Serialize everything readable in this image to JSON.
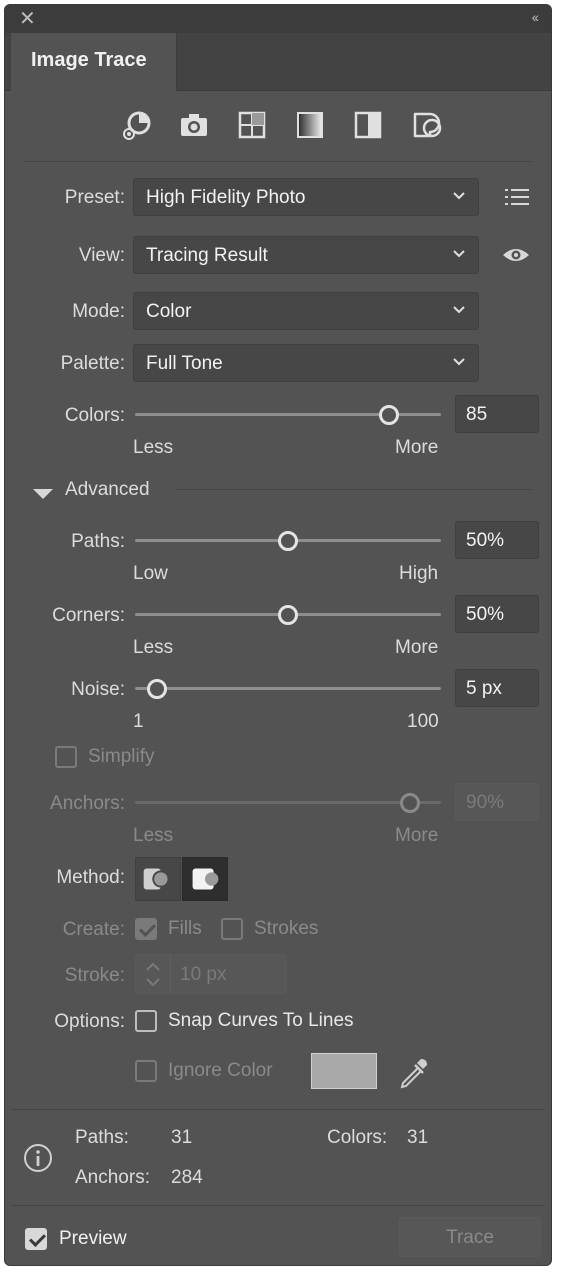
{
  "window": {
    "close_glyph": "✕",
    "collapse_glyph": "‹‹"
  },
  "tab": {
    "title": "Image Trace"
  },
  "presets_bar": [
    {
      "name": "auto-color-icon"
    },
    {
      "name": "high-color-icon"
    },
    {
      "name": "low-color-icon"
    },
    {
      "name": "grayscale-icon"
    },
    {
      "name": "black-and-white-icon"
    },
    {
      "name": "outline-icon"
    }
  ],
  "preset": {
    "label": "Preset:",
    "value": "High Fidelity Photo"
  },
  "view": {
    "label": "View:",
    "value": "Tracing Result"
  },
  "mode": {
    "label": "Mode:",
    "value": "Color"
  },
  "palette": {
    "label": "Palette:",
    "value": "Full Tone"
  },
  "colors": {
    "label": "Colors:",
    "value": "85",
    "min_label": "Less",
    "max_label": "More",
    "level": 0.83
  },
  "advanced": {
    "label": "Advanced"
  },
  "paths": {
    "label": "Paths:",
    "value": "50%",
    "min_label": "Low",
    "max_label": "High",
    "level": 0.5
  },
  "corners": {
    "label": "Corners:",
    "value": "50%",
    "min_label": "Less",
    "max_label": "More",
    "level": 0.5
  },
  "noise": {
    "label": "Noise:",
    "value": "5 px",
    "min_label": "1",
    "max_label": "100",
    "level": 0.04
  },
  "simplify": {
    "label": "Simplify"
  },
  "anchors": {
    "label": "Anchors:",
    "value": "90%",
    "min_label": "Less",
    "max_label": "More",
    "level": 0.9
  },
  "method": {
    "label": "Method:"
  },
  "create": {
    "label": "Create:",
    "fills": "Fills",
    "strokes": "Strokes"
  },
  "stroke": {
    "label": "Stroke:",
    "value": "10 px"
  },
  "options": {
    "label": "Options:",
    "snap": "Snap Curves To Lines",
    "ignore": "Ignore Color"
  },
  "stats": {
    "paths_label": "Paths:",
    "paths_value": "31",
    "colors_label": "Colors:",
    "colors_value": "31",
    "anchors_label": "Anchors:",
    "anchors_value": "284"
  },
  "footer": {
    "preview": "Preview",
    "trace": "Trace"
  }
}
